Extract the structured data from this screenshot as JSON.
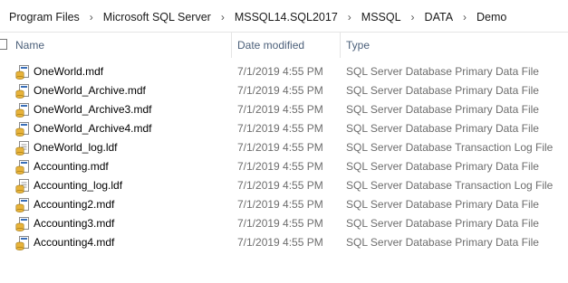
{
  "breadcrumb": [
    "Program Files",
    "Microsoft SQL Server",
    "MSSQL14.SQL2017",
    "MSSQL",
    "DATA",
    "Demo"
  ],
  "columns": {
    "name": "Name",
    "date": "Date modified",
    "type": "Type"
  },
  "files": [
    {
      "name": "OneWorld.mdf",
      "date": "7/1/2019 4:55 PM",
      "type": "SQL Server Database Primary Data File",
      "icon": "sql-data-file-icon"
    },
    {
      "name": "OneWorld_Archive.mdf",
      "date": "7/1/2019 4:55 PM",
      "type": "SQL Server Database Primary Data File",
      "icon": "sql-data-file-icon"
    },
    {
      "name": "OneWorld_Archive3.mdf",
      "date": "7/1/2019 4:55 PM",
      "type": "SQL Server Database Primary Data File",
      "icon": "sql-data-file-icon"
    },
    {
      "name": "OneWorld_Archive4.mdf",
      "date": "7/1/2019 4:55 PM",
      "type": "SQL Server Database Primary Data File",
      "icon": "sql-data-file-icon"
    },
    {
      "name": "OneWorld_log.ldf",
      "date": "7/1/2019 4:55 PM",
      "type": "SQL Server Database Transaction Log File",
      "icon": "sql-log-file-icon"
    },
    {
      "name": "Accounting.mdf",
      "date": "7/1/2019 4:55 PM",
      "type": "SQL Server Database Primary Data File",
      "icon": "sql-data-file-icon"
    },
    {
      "name": "Accounting_log.ldf",
      "date": "7/1/2019 4:55 PM",
      "type": "SQL Server Database Transaction Log File",
      "icon": "sql-log-file-icon"
    },
    {
      "name": "Accounting2.mdf",
      "date": "7/1/2019 4:55 PM",
      "type": "SQL Server Database Primary Data File",
      "icon": "sql-data-file-icon"
    },
    {
      "name": "Accounting3.mdf",
      "date": "7/1/2019 4:55 PM",
      "type": "SQL Server Database Primary Data File",
      "icon": "sql-data-file-icon"
    },
    {
      "name": "Accounting4.mdf",
      "date": "7/1/2019 4:55 PM",
      "type": "SQL Server Database Primary Data File",
      "icon": "sql-data-file-icon"
    }
  ],
  "colors": {
    "header_text": "#4c607a",
    "meta_text": "#6d6d6d",
    "icon_gold": "#e8b33a",
    "icon_blue": "#3a6fb8"
  }
}
